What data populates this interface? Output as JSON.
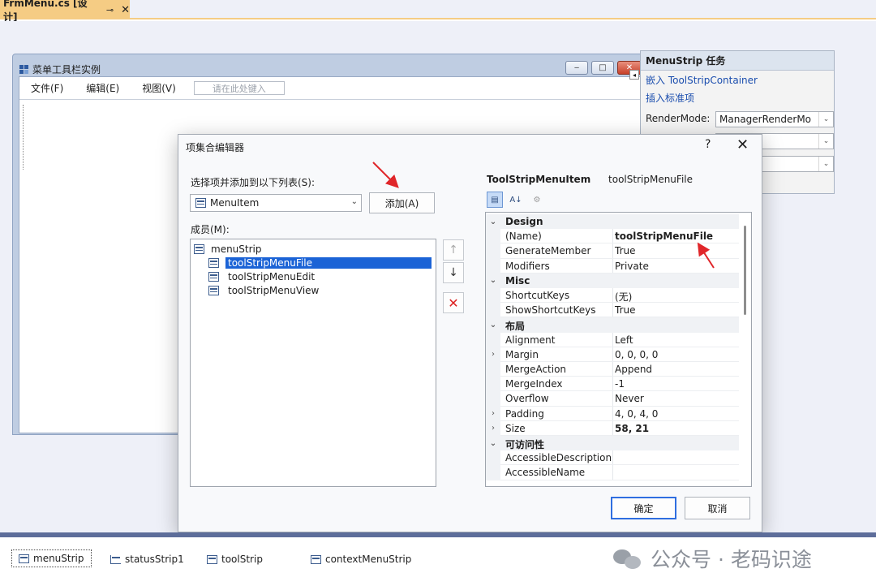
{
  "doc_tab": {
    "title": "FrmMenu.cs [设计]",
    "pin_glyph": "⊸",
    "close_glyph": "✕"
  },
  "form": {
    "title": "菜单工具栏实例",
    "controls": {
      "minimize": "‒",
      "maximize": "□",
      "close": "✕"
    },
    "menu_items": [
      "文件(F)",
      "编辑(E)",
      "视图(V)"
    ],
    "type_here": "请在此处键入"
  },
  "tasks_panel": {
    "title": "MenuStrip 任务",
    "links": [
      "嵌入 ToolStripContainer",
      "插入标准项"
    ],
    "render_mode_label": "RenderMode:",
    "render_mode_value": "ManagerRenderMo",
    "extra_combos": [
      "",
      ""
    ]
  },
  "dialog": {
    "title": "项集合编辑器",
    "help": "?",
    "close": "✕",
    "select_label": "选择项并添加到以下列表(S):",
    "item_type": "MenuItem",
    "add_button": "添加(A)",
    "members_label": "成员(M):",
    "tree": {
      "root": "menuStrip",
      "children": [
        "toolStripMenuFile",
        "toolStripMenuEdit",
        "toolStripMenuView"
      ],
      "selected_index": 0
    },
    "side_buttons": {
      "up": "↑",
      "down": "↓",
      "remove": "✕"
    },
    "property_header": {
      "type": "ToolStripMenuItem",
      "name": "toolStripMenuFile"
    },
    "property_rows": [
      {
        "kind": "cat",
        "expander": "⌄",
        "name": "Design",
        "value": ""
      },
      {
        "kind": "prop",
        "expander": "",
        "name": "(Name)",
        "value": "toolStripMenuFile",
        "bold": true
      },
      {
        "kind": "prop",
        "expander": "",
        "name": "GenerateMember",
        "value": "True"
      },
      {
        "kind": "prop",
        "expander": "",
        "name": "Modifiers",
        "value": "Private"
      },
      {
        "kind": "cat",
        "expander": "⌄",
        "name": "Misc",
        "value": ""
      },
      {
        "kind": "prop",
        "expander": "",
        "name": "ShortcutKeys",
        "value": "(无)"
      },
      {
        "kind": "prop",
        "expander": "",
        "name": "ShowShortcutKeys",
        "value": "True"
      },
      {
        "kind": "cat",
        "expander": "⌄",
        "name": "布局",
        "value": ""
      },
      {
        "kind": "prop",
        "expander": "",
        "name": "Alignment",
        "value": "Left"
      },
      {
        "kind": "prop",
        "expander": "›",
        "name": "Margin",
        "value": "0, 0, 0, 0"
      },
      {
        "kind": "prop",
        "expander": "",
        "name": "MergeAction",
        "value": "Append"
      },
      {
        "kind": "prop",
        "expander": "",
        "name": "MergeIndex",
        "value": "-1"
      },
      {
        "kind": "prop",
        "expander": "",
        "name": "Overflow",
        "value": "Never"
      },
      {
        "kind": "prop",
        "expander": "›",
        "name": "Padding",
        "value": "4, 0, 4, 0"
      },
      {
        "kind": "prop",
        "expander": "›",
        "name": "Size",
        "value": "58, 21",
        "bold": true
      },
      {
        "kind": "cat",
        "expander": "⌄",
        "name": "可访问性",
        "value": ""
      },
      {
        "kind": "prop",
        "expander": "",
        "name": "AccessibleDescription",
        "value": ""
      },
      {
        "kind": "prop",
        "expander": "",
        "name": "AccessibleName",
        "value": ""
      }
    ],
    "ok_button": "确定",
    "cancel_button": "取消"
  },
  "tray": {
    "items": [
      "menuStrip",
      "statusStrip1",
      "toolStrip",
      "contextMenuStrip"
    ],
    "selected_index": 0
  },
  "watermark": "公众号 · 老码识途",
  "colors": {
    "tab_active": "#f5cc84",
    "selection": "#1b63d6",
    "annotation_arrow": "#e0262a",
    "tray_border": "#5d6d9a"
  }
}
